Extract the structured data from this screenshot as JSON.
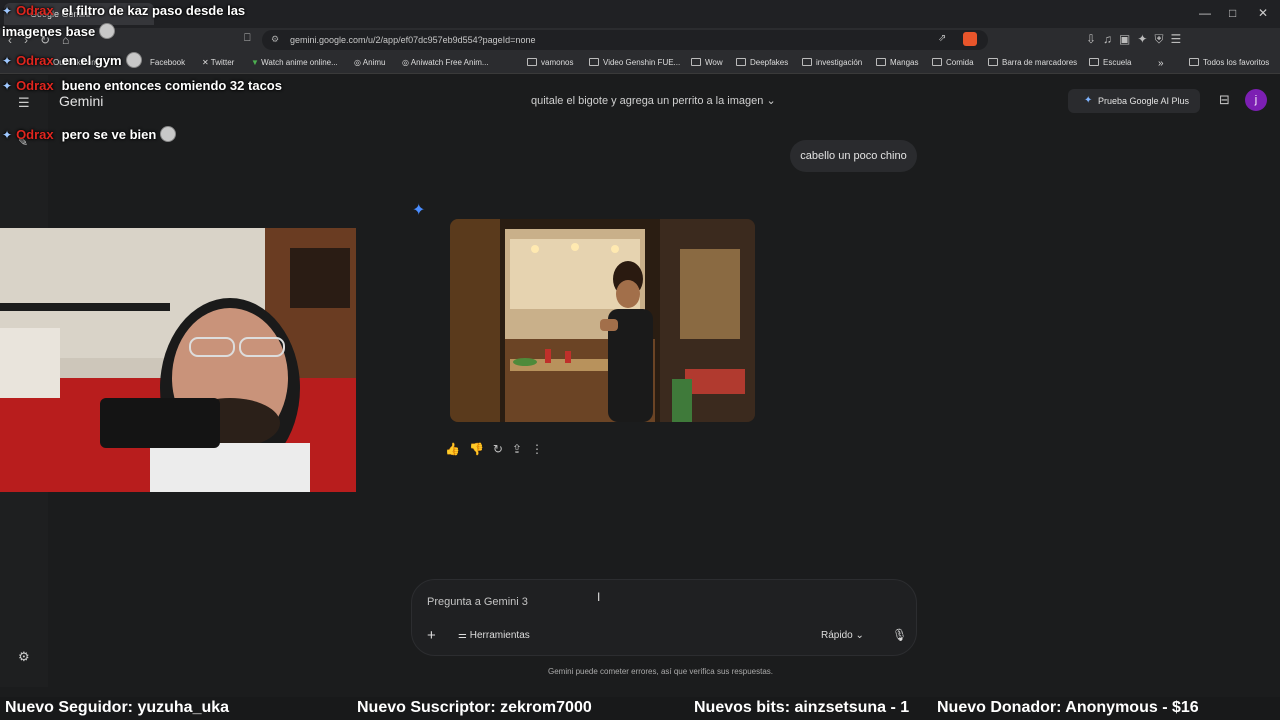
{
  "browser": {
    "tab_title": "Google Gemini",
    "url": "gemini.google.com/u/2/app/ef07dc957eb9d554?pageId=none",
    "bookmarks": [
      "Outlook.com",
      "Facebook",
      "Twitter",
      "Watch anime online...",
      "Animu",
      "Aniwatch Free Anim...",
      "vamonos",
      "Video Genshin FUE...",
      "Wow",
      "Deepfakes",
      "investigación",
      "Mangas",
      "Comida",
      "Barra de marcadores",
      "Escuela"
    ],
    "all_bookmarks": "Todos los favoritos"
  },
  "app": {
    "brand": "Gemini",
    "conversation_title": "quitale el bigote y agrega un perrito a la imagen",
    "upgrade_label": "Prueba Google AI Plus",
    "avatar_initial": "j"
  },
  "conversation": {
    "user_message": "cabello un poco chino"
  },
  "composer": {
    "placeholder": "Pregunta a Gemini 3",
    "tools_label": "Herramientas",
    "mode_label": "Rápido",
    "disclaimer": "Gemini puede cometer errores, así que verifica sus respuestas."
  },
  "stream_chat": [
    {
      "user": "Odrax",
      "text": "el filtro de kaz paso desde las"
    },
    {
      "user": "",
      "text": "imagenes base"
    },
    {
      "user": "Odrax",
      "text": "en el gym"
    },
    {
      "user": "Odrax",
      "text": "bueno entonces comiendo 32 tacos"
    },
    {
      "user": "Odrax",
      "text": "pero se ve bien"
    }
  ],
  "ticker": {
    "follower": "Nuevo Seguidor: yuzuha_uka",
    "subscriber": "Nuevo Suscriptor: zekrom7000",
    "bits": "Nuevos bits: ainzsetsuna - 1",
    "donor": "Nuevo Donador: Anonymous - $16"
  },
  "colors": {
    "background": "#1b1c1d",
    "accent_blue": "#4a8dff",
    "avatar": "#7c1fb3",
    "chat_username": "#e0261f"
  }
}
